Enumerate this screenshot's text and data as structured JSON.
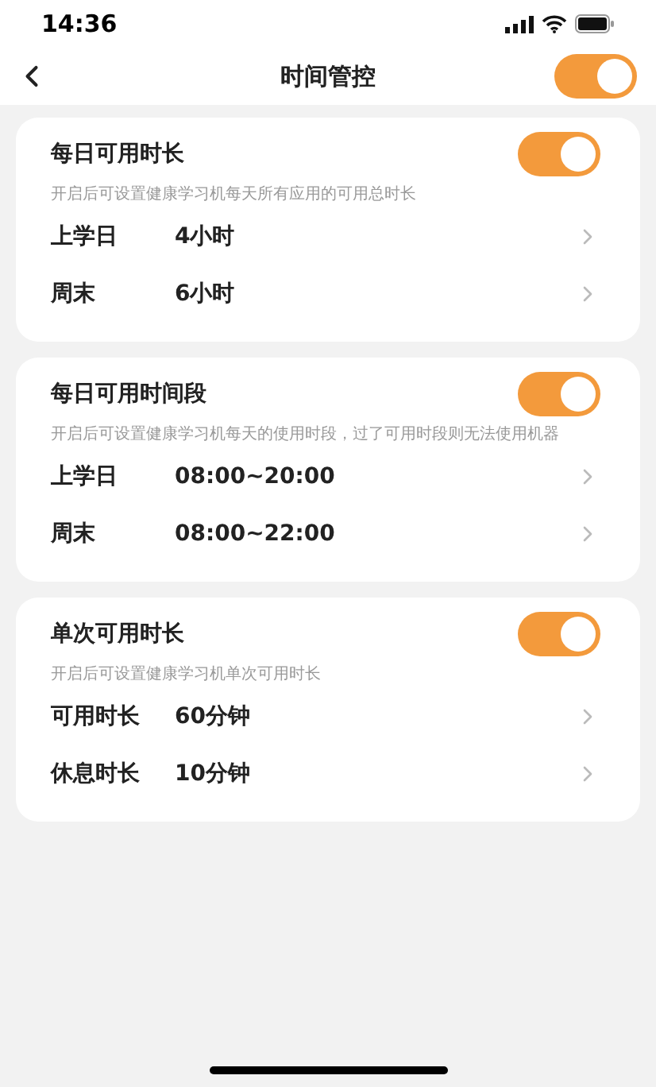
{
  "status_bar": {
    "time": "14:36"
  },
  "nav": {
    "title": "时间管控",
    "master_switch": {
      "on": true
    }
  },
  "sections": [
    {
      "title": "每日可用时长",
      "on": true,
      "description": "开启后可设置健康学习机每天所有应用的可用总时长",
      "rows": [
        {
          "label": "上学日",
          "value": "4小时"
        },
        {
          "label": "周末",
          "value": "6小时"
        }
      ]
    },
    {
      "title": "每日可用时间段",
      "on": true,
      "description": "开启后可设置健康学习机每天的使用时段，过了可用时段则无法使用机器",
      "rows": [
        {
          "label": "上学日",
          "value": "08:00~20:00"
        },
        {
          "label": "周末",
          "value": "08:00~22:00"
        }
      ]
    },
    {
      "title": "单次可用时长",
      "on": true,
      "description": "开启后可设置健康学习机单次可用时长",
      "rows": [
        {
          "label": "可用时长",
          "value": "60分钟"
        },
        {
          "label": "休息时长",
          "value": "10分钟"
        }
      ]
    }
  ]
}
